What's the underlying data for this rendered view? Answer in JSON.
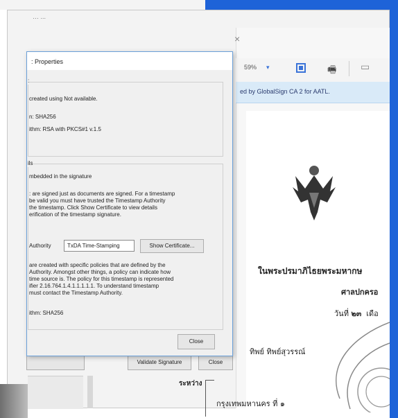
{
  "outer_window": {
    "title": "… ...",
    "close_glyph": "×"
  },
  "toolbar": {
    "zoom_value": "59%",
    "zoom_caret": "▾",
    "fit_icon": "fit-page-icon",
    "stamp_icon": "stamp-icon",
    "comment_icon": "comment-icon"
  },
  "signature_bar": {
    "text": "ed by GlobalSign CA 2 for AATL."
  },
  "dialog": {
    "title": ": Properties",
    "group1": {
      "line0": ":",
      "line1": "created using Not available.",
      "line2": "n: SHA256",
      "line3": "ithm: RSA with PKCS#1 v.1.5"
    },
    "group2": {
      "heading": "ils",
      "line1": "mbedded in the signature",
      "para1": [
        ": are signed just as documents are signed. For a timestamp",
        " be valid you must have trusted the Timestamp Authority",
        "the timestamp. Click Show Certificate to view details",
        "erification of the timestamp signature."
      ],
      "authority_label": "Authority",
      "authority_value": "TxDA Time-Stamping",
      "show_certificate": "Show Certificate...",
      "para2": [
        "are created with specific policies that are defined by the",
        "Authority. Amongst other things, a policy can indicate how",
        "time source is. The policy for this timestamp is represented",
        "ifier 2.16.764.1.4.1.1.1.1.1. To understand timestamp",
        "must contact the Timestamp Authority."
      ],
      "algorithm": "ithm: SHA256"
    },
    "close_label": "Close"
  },
  "outer_buttons": {
    "validate": "Validate Signature",
    "close": "Close"
  },
  "document": {
    "line1": "ในพระปรมาภิไธยพระมหากษ",
    "line2": "ศาลปกครอ",
    "line3_prefix": "วันที่",
    "line3_num": "๒๓",
    "line3_suffix": "เดือ",
    "line4": "ทิพย์ ทิพย์สุวรรณ์",
    "line5": "กรุงเทพมหานคร ที่ ๑",
    "bracket_label": "ระหว่าง"
  },
  "colors": {
    "accent_blue": "#1e63d8",
    "signature_bar": "#d9eaf8"
  }
}
